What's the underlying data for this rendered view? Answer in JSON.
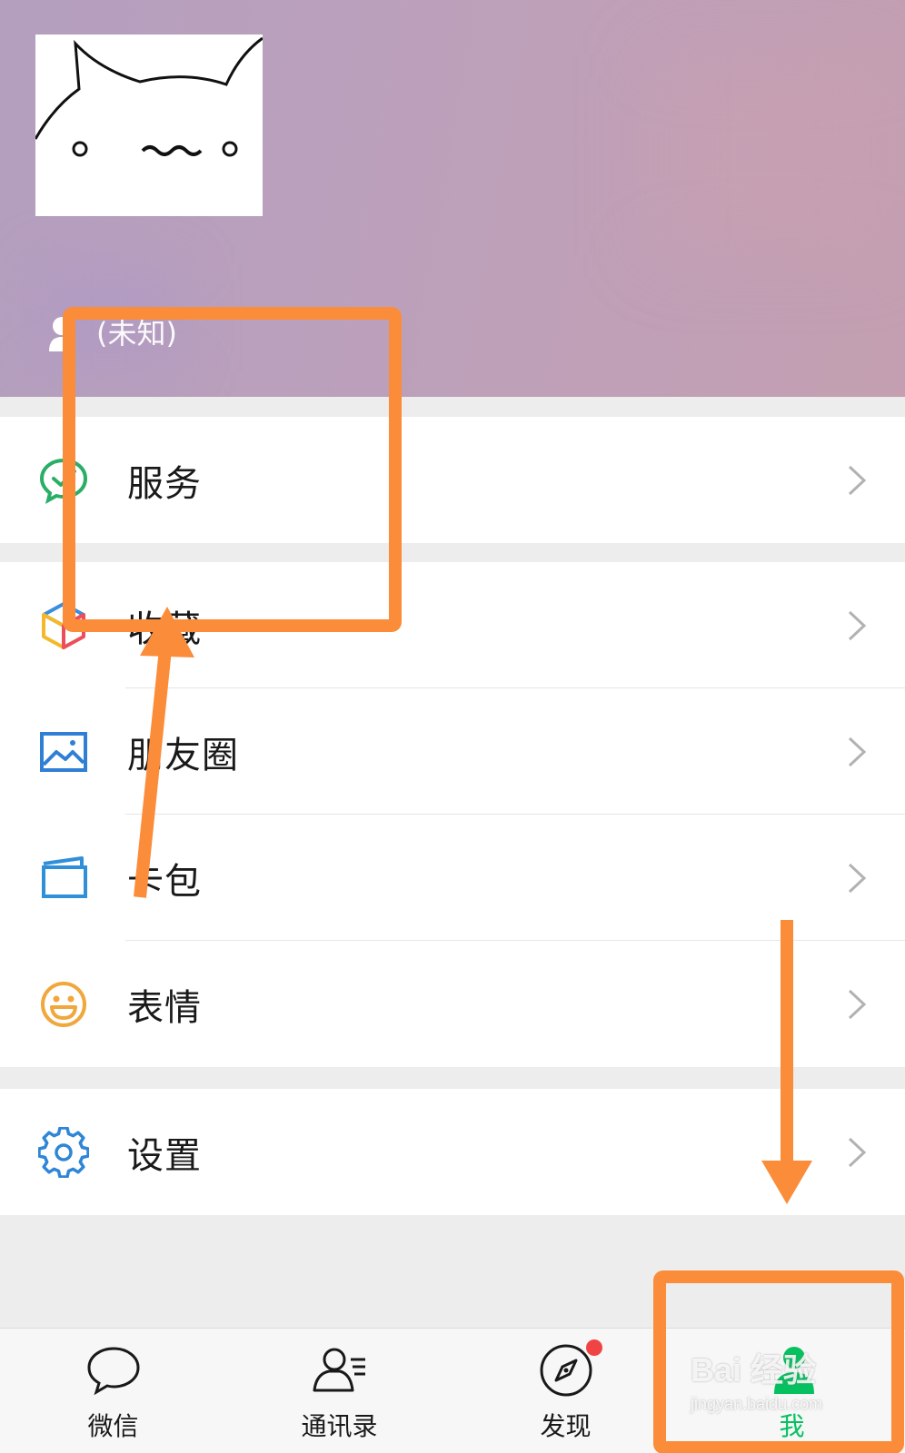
{
  "profile": {
    "gender_text": "(未知)"
  },
  "menu": {
    "groups": [
      {
        "items": [
          {
            "label": "服务",
            "icon": "wechat-pay-icon"
          }
        ]
      },
      {
        "items": [
          {
            "label": "收藏",
            "icon": "favorites-cube-icon"
          },
          {
            "label": "朋友圈",
            "icon": "moments-photo-icon"
          },
          {
            "label": "卡包",
            "icon": "card-wallet-icon"
          },
          {
            "label": "表情",
            "icon": "sticker-smiley-icon"
          }
        ]
      },
      {
        "items": [
          {
            "label": "设置",
            "icon": "gear-icon"
          }
        ]
      }
    ]
  },
  "tabs": [
    {
      "label": "微信",
      "icon": "chat-bubble-icon",
      "active": false,
      "badge": false
    },
    {
      "label": "通讯录",
      "icon": "contacts-icon",
      "active": false,
      "badge": false
    },
    {
      "label": "发现",
      "icon": "compass-icon",
      "active": false,
      "badge": true
    },
    {
      "label": "我",
      "icon": "me-person-icon",
      "active": true,
      "badge": false
    }
  ],
  "watermark": {
    "main": "Bai 经验",
    "sub": "jingyan.baidu.com"
  },
  "colors": {
    "accent_green": "#07c160",
    "annotation_orange": "#fb8c3a",
    "header_purple": "#bca0bb",
    "badge_red": "#f04444"
  }
}
